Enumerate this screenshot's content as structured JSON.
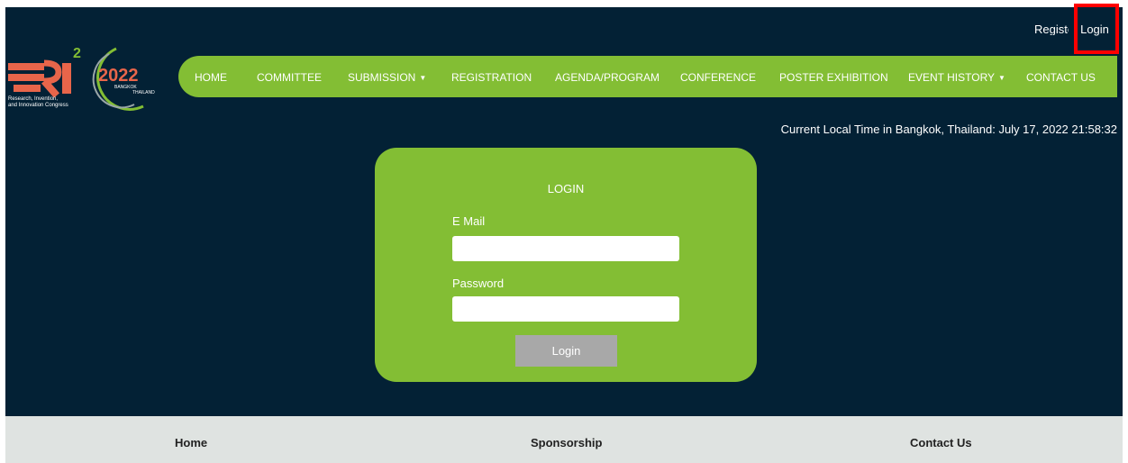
{
  "top_links": {
    "register": "Register",
    "login": "Login"
  },
  "logo": {
    "brand": "RI",
    "superscript": "2",
    "year": "2022",
    "city": "BANGKOK",
    "country": "THAILAND",
    "tagline1": "Research, Invention,",
    "tagline2": "and Innovation Congress"
  },
  "nav": [
    {
      "label": "HOME"
    },
    {
      "label": "COMMITTEE"
    },
    {
      "label": "SUBMISSION",
      "has_dropdown": true
    },
    {
      "label": "REGISTRATION"
    },
    {
      "label": "AGENDA/PROGRAM"
    },
    {
      "label": "CONFERENCE"
    },
    {
      "label": "POSTER EXHIBITION"
    },
    {
      "label": "EVENT HISTORY",
      "has_dropdown": true
    },
    {
      "label": "CONTACT US"
    }
  ],
  "time_text": "Current Local Time in Bangkok, Thailand: July 17, 2022 21:58:32",
  "login_form": {
    "title": "LOGIN",
    "email_label": "E Mail",
    "email_value": "",
    "password_label": "Password",
    "password_value": "",
    "button_label": "Login"
  },
  "footer": [
    {
      "label": "Home"
    },
    {
      "label": "Sponsorship"
    },
    {
      "label": "Contact Us"
    }
  ],
  "colors": {
    "background": "#032135",
    "accent_green": "#83be34",
    "button_gray": "#a8a8a8",
    "footer_bg": "#dfe3e1",
    "highlight": "#ff0000"
  }
}
